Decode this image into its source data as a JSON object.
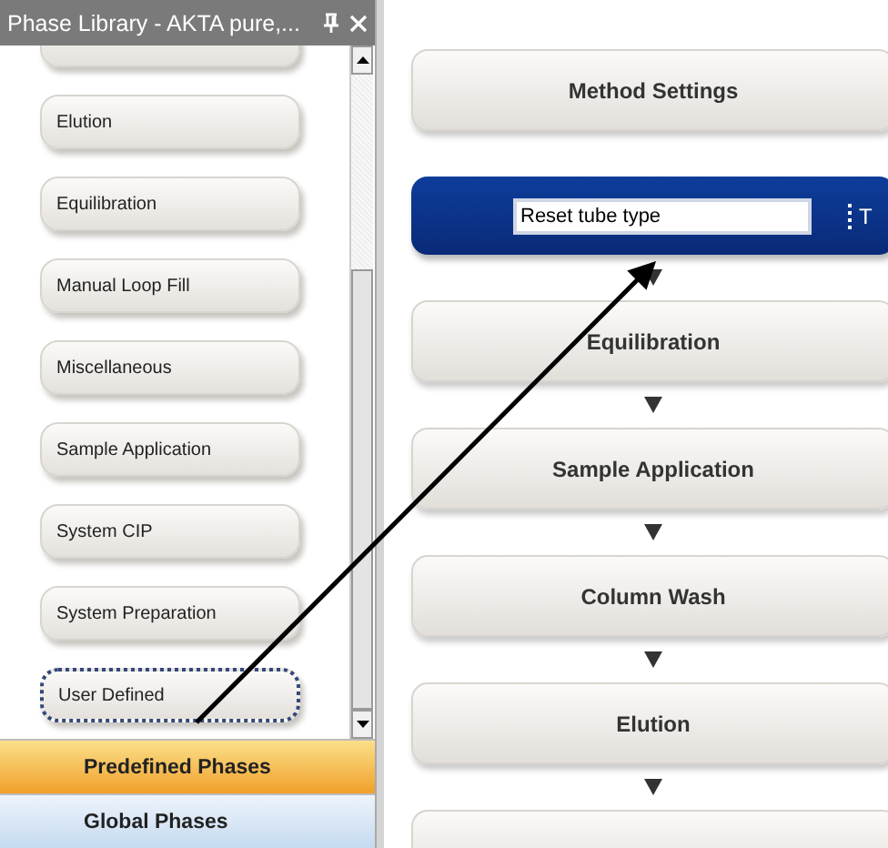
{
  "panel": {
    "title": "Phase Library - AKTA pure,...",
    "phases": [
      {
        "kind": "hidden"
      },
      {
        "kind": "phase",
        "label": "Elution",
        "focused": false
      },
      {
        "kind": "phase",
        "label": "Equilibration",
        "focused": false
      },
      {
        "kind": "phase",
        "label": "Manual Loop Fill",
        "focused": false
      },
      {
        "kind": "phase",
        "label": "Miscellaneous",
        "focused": false
      },
      {
        "kind": "phase",
        "label": "Sample Application",
        "focused": false
      },
      {
        "kind": "phase",
        "label": "System CIP",
        "focused": false
      },
      {
        "kind": "phase",
        "label": "System Preparation",
        "focused": false
      },
      {
        "kind": "phase",
        "label": "User Defined",
        "focused": true
      }
    ]
  },
  "tabs": [
    {
      "label": "Predefined Phases",
      "selected": true
    },
    {
      "label": "Global Phases",
      "selected": false
    }
  ],
  "method": {
    "steps": [
      {
        "kind": "block",
        "label": "Method Settings"
      },
      {
        "kind": "editing",
        "value": "Reset tube type",
        "side_label": "T",
        "connector": false
      },
      {
        "kind": "block",
        "label": "Equilibration",
        "connector": true
      },
      {
        "kind": "block",
        "label": "Sample Application",
        "connector": true
      },
      {
        "kind": "block",
        "label": "Column Wash",
        "connector": true
      },
      {
        "kind": "block",
        "label": "Elution",
        "connector": true
      },
      {
        "kind": "partial",
        "connector": true
      }
    ]
  }
}
